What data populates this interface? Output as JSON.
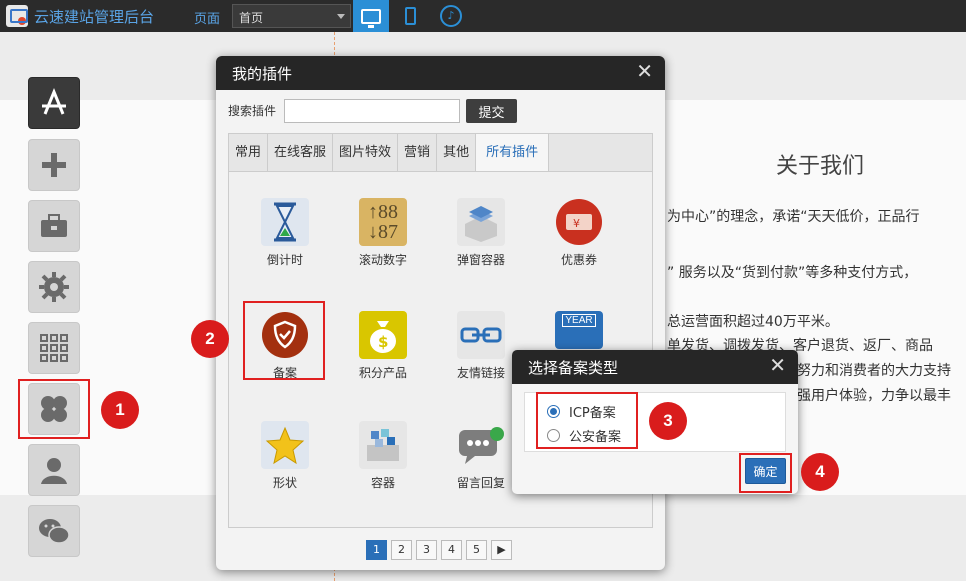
{
  "topbar": {
    "app_title": "云速建站管理后台",
    "page_label": "页面",
    "page_select_value": "首页",
    "device_desktop_icon": "desktop-icon",
    "device_mobile_icon": "mobile-icon",
    "device_app_icon": "app-icon"
  },
  "background": {
    "about_title": "关于我们",
    "lines": [
      "为中心”的理念，承诺“天天低价，正品行",
      "” 服务以及“货到付款”等多种支付方式，",
      "总运营面积超过40万平米。",
      "单发货、调拨发货、客户退货、返厂、商品",
      "努力和消费者的大力支持",
      "强用户体验，力争以最丰"
    ]
  },
  "toolbar": {
    "items": [
      "app-store-icon",
      "plus-icon",
      "toolbox-icon",
      "gear-icon",
      "grid-icon",
      "plugin-icon",
      "user-icon",
      "wechat-icon"
    ]
  },
  "plugin_dialog": {
    "title": "我的插件",
    "search_label": "搜索插件",
    "search_value": "",
    "submit_label": "提交",
    "tabs": [
      "常用",
      "在线客服",
      "图片特效",
      "营销",
      "其他",
      "所有插件"
    ],
    "active_tab": "所有插件",
    "plugins": [
      {
        "label": "倒计时",
        "icon": "hourglass-icon"
      },
      {
        "label": "滚动数字",
        "icon": "counter-icon"
      },
      {
        "label": "弹窗容器",
        "icon": "layers-icon"
      },
      {
        "label": "优惠券",
        "icon": "coupon-icon"
      },
      {
        "label": "备案",
        "icon": "shield-icon"
      },
      {
        "label": "积分产品",
        "icon": "money-bag-icon"
      },
      {
        "label": "友情链接",
        "icon": "link-icon"
      },
      {
        "label": "形状",
        "icon": "star-icon"
      },
      {
        "label": "容器",
        "icon": "box-icon"
      },
      {
        "label": "留言回复",
        "icon": "message-icon"
      }
    ],
    "calendar_badge": "YEAR",
    "pages": [
      "1",
      "2",
      "3",
      "4",
      "5"
    ],
    "current_page": "1"
  },
  "icp_dialog": {
    "title": "选择备案类型",
    "options": [
      "ICP备案",
      "公安备案"
    ],
    "selected": "ICP备案",
    "confirm_label": "确定"
  },
  "badges": [
    "1",
    "2",
    "3",
    "4"
  ],
  "colors": {
    "accent": "#2a6fb8",
    "highlight": "#e02020",
    "badge": "#d91c1c",
    "topbar": "#2b2b2b"
  }
}
